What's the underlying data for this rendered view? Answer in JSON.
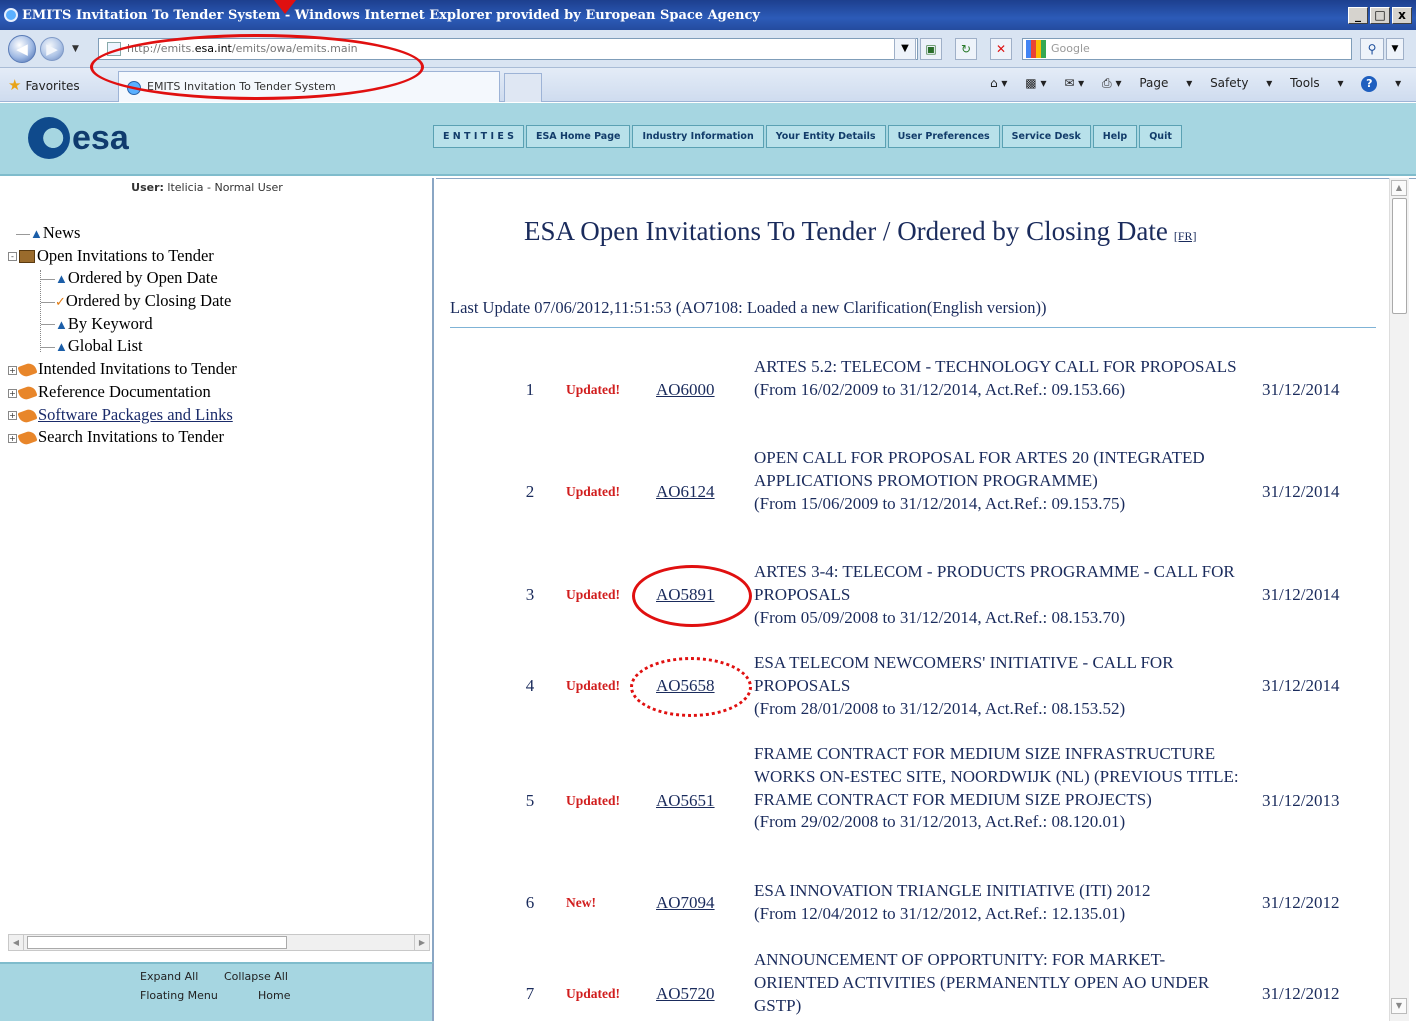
{
  "window": {
    "title": "EMITS Invitation To Tender System - Windows Internet Explorer provided by European Space Agency",
    "buttons": [
      "_",
      "□",
      "x"
    ]
  },
  "addressbar": {
    "url_prefix": "http://emits.",
    "url_host": "esa.int",
    "url_suffix": "/emits/owa/emits.main",
    "search_placeholder": "Google"
  },
  "favbar": {
    "favorites_label": "Favorites",
    "tab_title": "EMITS Invitation To Tender System",
    "page_menu": "Page",
    "safety_menu": "Safety",
    "tools_menu": "Tools"
  },
  "esa": {
    "logo_text": "esa",
    "menu": [
      "E N T I T I E S",
      "ESA Home Page",
      "Industry Information",
      "Your Entity Details",
      "User Preferences",
      "Service Desk",
      "Help",
      "Quit"
    ]
  },
  "sidebar": {
    "user_label": "User:",
    "user_value": "ltelicia - Normal User",
    "tree": [
      {
        "label": "News"
      },
      {
        "label": "Open Invitations to Tender"
      },
      {
        "label": "Ordered by Open Date"
      },
      {
        "label": "Ordered by Closing Date"
      },
      {
        "label": "By Keyword"
      },
      {
        "label": "Global List"
      },
      {
        "label": "Intended Invitations to Tender"
      },
      {
        "label": "Reference Documentation"
      },
      {
        "label": "Software Packages and Links"
      },
      {
        "label": "Search Invitations to Tender"
      }
    ],
    "footer": {
      "expand_all": "Expand All",
      "collapse_all": "Collapse All",
      "floating_menu": "Floating Menu",
      "home": "Home"
    }
  },
  "main": {
    "title": "ESA Open Invitations To Tender / Ordered by Closing Date",
    "fr_link": "[FR]",
    "last_update": "Last Update 07/06/2012,11:51:53 (AO7108: Loaded a new Clarification(English version))",
    "rows": [
      {
        "num": "1",
        "badge": "Updated!",
        "ao": "AO6000",
        "title": "ARTES 5.2: TELECOM - TECHNOLOGY CALL FOR PROPOSALS",
        "period": "(From 16/02/2009 to 31/12/2014, Act.Ref.: 09.153.66)",
        "date": "31/12/2014"
      },
      {
        "num": "2",
        "badge": "Updated!",
        "ao": "AO6124",
        "title": "OPEN CALL FOR PROPOSAL FOR ARTES 20 (INTEGRATED APPLICATIONS PROMOTION PROGRAMME)",
        "period": "(From 15/06/2009 to 31/12/2014, Act.Ref.: 09.153.75)",
        "date": "31/12/2014"
      },
      {
        "num": "3",
        "badge": "Updated!",
        "ao": "AO5891",
        "title": "ARTES 3-4: TELECOM - PRODUCTS PROGRAMME - CALL FOR PROPOSALS",
        "period": "(From 05/09/2008 to 31/12/2014, Act.Ref.: 08.153.70)",
        "date": "31/12/2014"
      },
      {
        "num": "4",
        "badge": "Updated!",
        "ao": "AO5658",
        "title": "ESA TELECOM NEWCOMERS' INITIATIVE - CALL FOR PROPOSALS",
        "period": "(From 28/01/2008 to 31/12/2014, Act.Ref.: 08.153.52)",
        "date": "31/12/2014"
      },
      {
        "num": "5",
        "badge": "Updated!",
        "ao": "AO5651",
        "title": "FRAME CONTRACT FOR MEDIUM SIZE INFRASTRUCTURE WORKS ON-ESTEC SITE, NOORDWIJK (NL) (PREVIOUS TITLE: FRAME CONTRACT FOR MEDIUM SIZE PROJECTS)",
        "period": "(From 29/02/2008 to 31/12/2013, Act.Ref.: 08.120.01)",
        "date": "31/12/2013"
      },
      {
        "num": "6",
        "badge": "New!",
        "ao": "AO7094",
        "title": "ESA INNOVATION TRIANGLE INITIATIVE (ITI) 2012",
        "period": "(From 12/04/2012 to 31/12/2012, Act.Ref.: 12.135.01)",
        "date": "31/12/2012"
      },
      {
        "num": "7",
        "badge": "Updated!",
        "ao": "AO5720",
        "title": "ANNOUNCEMENT OF OPPORTUNITY: FOR MARKET-ORIENTED ACTIVITIES (PERMANENTLY OPEN AO UNDER GSTP)",
        "period": "",
        "date": "31/12/2012"
      }
    ]
  }
}
